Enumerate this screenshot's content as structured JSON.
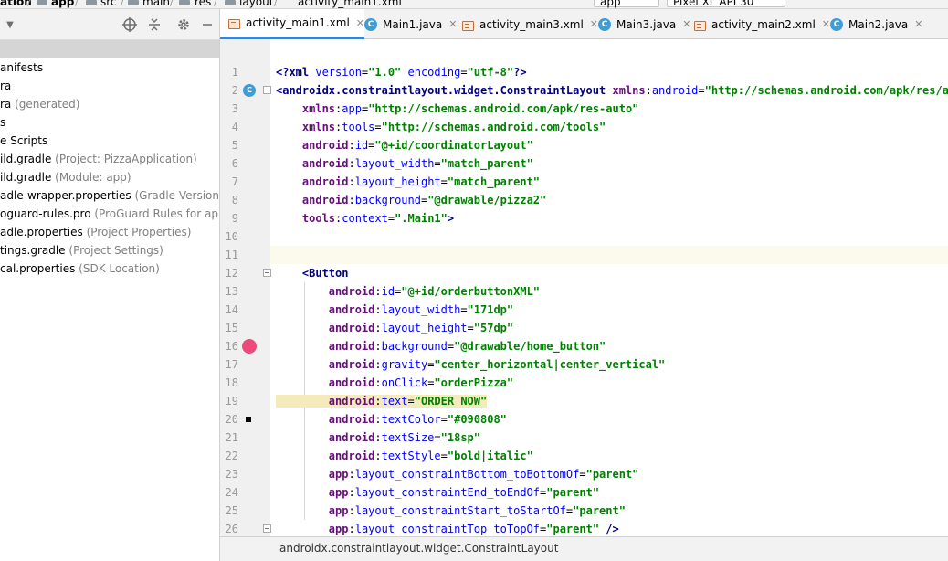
{
  "topbar": {
    "project": "ation",
    "module": "app",
    "path": [
      "src",
      "main",
      "res",
      "layout",
      "activity_main1.xml"
    ],
    "run_config": "app",
    "device": "Pixel XL API 30"
  },
  "project_panel": {
    "tree": [
      {
        "label": "anifests",
        "hint": ""
      },
      {
        "label": "ra",
        "hint": ""
      },
      {
        "label": "ra",
        "hint": "(generated)"
      },
      {
        "label": "s",
        "hint": ""
      },
      {
        "label": "e Scripts",
        "hint": ""
      },
      {
        "label": "ild.gradle",
        "hint": "(Project: PizzaApplication)"
      },
      {
        "label": "ild.gradle",
        "hint": "(Module: app)"
      },
      {
        "label": "adle-wrapper.properties",
        "hint": "(Gradle Version)"
      },
      {
        "label": "oguard-rules.pro",
        "hint": "(ProGuard Rules for app)"
      },
      {
        "label": "adle.properties",
        "hint": "(Project Properties)"
      },
      {
        "label": "tings.gradle",
        "hint": "(Project Settings)"
      },
      {
        "label": "cal.properties",
        "hint": "(SDK Location)"
      }
    ]
  },
  "tabs": [
    {
      "label": "activity_main1.xml",
      "type": "xml",
      "active": true
    },
    {
      "label": "Main1.java",
      "type": "class",
      "active": false
    },
    {
      "label": "activity_main3.xml",
      "type": "xml",
      "active": false
    },
    {
      "label": "Main3.java",
      "type": "class",
      "active": false
    },
    {
      "label": "activity_main2.xml",
      "type": "xml",
      "active": false
    },
    {
      "label": "Main2.java",
      "type": "class",
      "active": false
    }
  ],
  "editor": {
    "lines": [
      {
        "n": "1",
        "text": "<?xml version=\"1.0\" encoding=\"utf-8\"?>"
      },
      {
        "n": "2",
        "text": "<androidx.constraintlayout.widget.ConstraintLayout xmlns:android=\"http://schemas.android.com/apk/res/android\""
      },
      {
        "n": "3",
        "text": "    xmlns:app=\"http://schemas.android.com/apk/res-auto\""
      },
      {
        "n": "4",
        "text": "    xmlns:tools=\"http://schemas.android.com/tools\""
      },
      {
        "n": "5",
        "text": "    android:id=\"@+id/coordinatorLayout\""
      },
      {
        "n": "6",
        "text": "    android:layout_width=\"match_parent\""
      },
      {
        "n": "7",
        "text": "    android:layout_height=\"match_parent\""
      },
      {
        "n": "8",
        "text": "    android:background=\"@drawable/pizza2\""
      },
      {
        "n": "9",
        "text": "    tools:context=\".Main1\">"
      },
      {
        "n": "10",
        "text": ""
      },
      {
        "n": "11",
        "text": ""
      },
      {
        "n": "12",
        "text": "    <Button"
      },
      {
        "n": "13",
        "text": "        android:id=\"@+id/orderbuttonXML\""
      },
      {
        "n": "14",
        "text": "        android:layout_width=\"171dp\""
      },
      {
        "n": "15",
        "text": "        android:layout_height=\"57dp\""
      },
      {
        "n": "16",
        "text": "        android:background=\"@drawable/home_button\""
      },
      {
        "n": "17",
        "text": "        android:gravity=\"center_horizontal|center_vertical\""
      },
      {
        "n": "18",
        "text": "        android:onClick=\"orderPizza\""
      },
      {
        "n": "19",
        "text": "        android:text=\"ORDER NOW\""
      },
      {
        "n": "20",
        "text": "        android:textColor=\"#090808\""
      },
      {
        "n": "21",
        "text": "        android:textSize=\"18sp\""
      },
      {
        "n": "22",
        "text": "        android:textStyle=\"bold|italic\""
      },
      {
        "n": "23",
        "text": "        app:layout_constraintBottom_toBottomOf=\"parent\""
      },
      {
        "n": "24",
        "text": "        app:layout_constraintEnd_toEndOf=\"parent\""
      },
      {
        "n": "25",
        "text": "        app:layout_constraintStart_toStartOf=\"parent\""
      },
      {
        "n": "26",
        "text": "        app:layout_constraintTop_toTopOf=\"parent\" />"
      }
    ],
    "current_line": "11",
    "highlighted_line": "19"
  },
  "statusbar": {
    "breadcrumb": "androidx.constraintlayout.widget.ConstraintLayout"
  },
  "colors": {
    "accent": "#4083c9",
    "breakpoint": "#eb4a7b",
    "tag": "#000080",
    "attribute": "#0000ff",
    "namespace": "#660e7a",
    "value": "#008000"
  }
}
